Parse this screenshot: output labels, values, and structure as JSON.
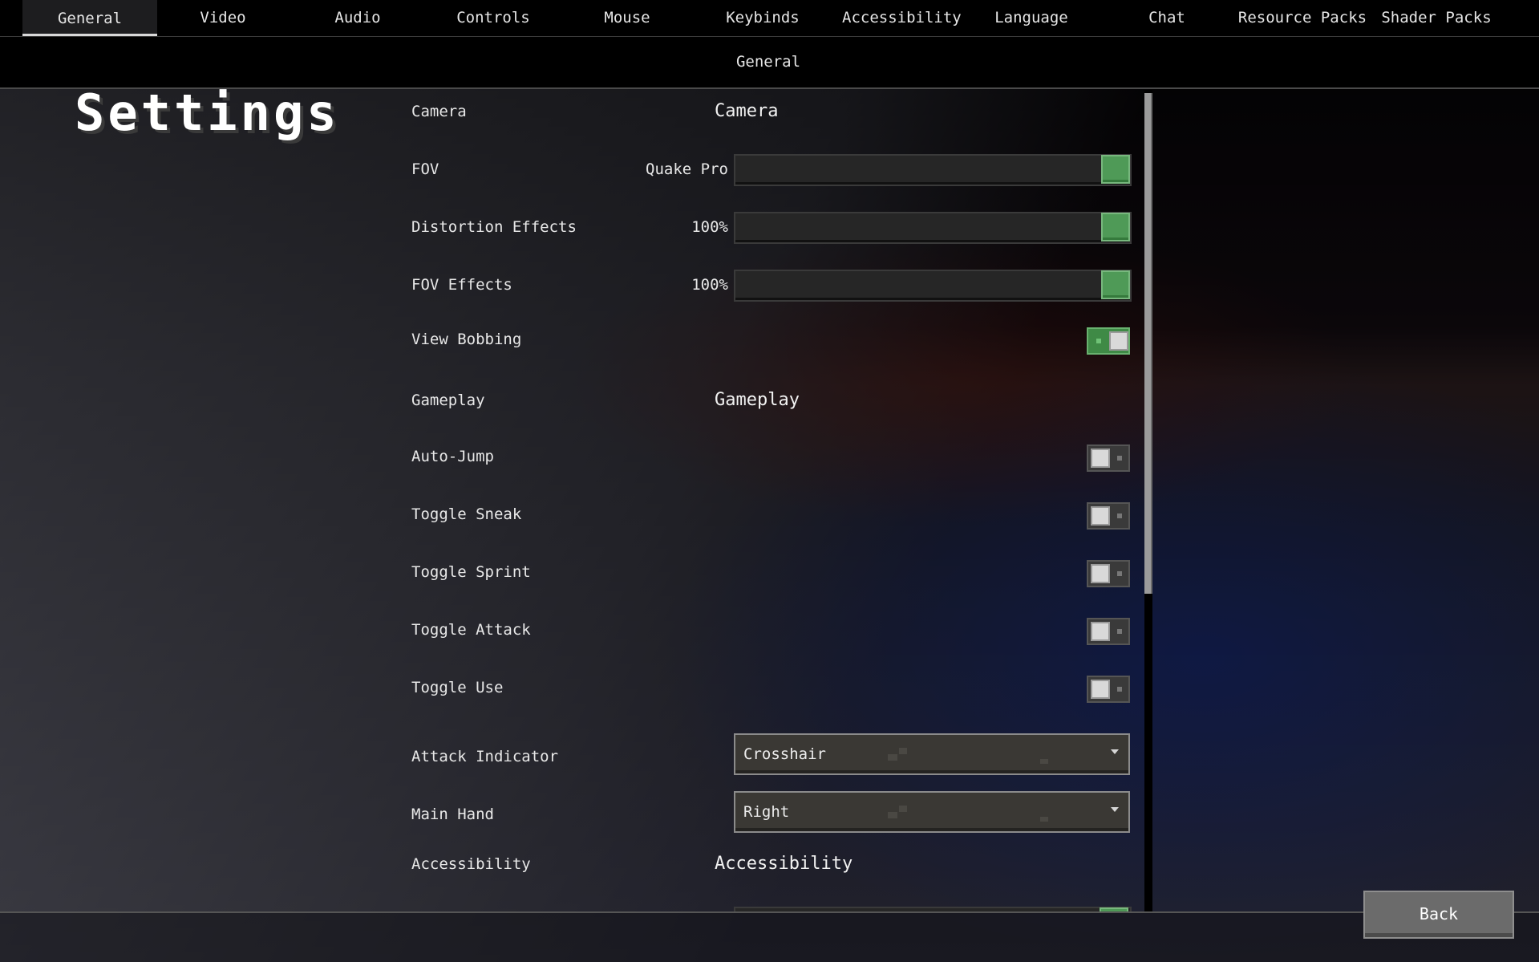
{
  "tabs": [
    {
      "id": "general",
      "label": "General",
      "active": true
    },
    {
      "id": "video",
      "label": "Video"
    },
    {
      "id": "audio",
      "label": "Audio"
    },
    {
      "id": "controls",
      "label": "Controls"
    },
    {
      "id": "mouse",
      "label": "Mouse"
    },
    {
      "id": "keybinds",
      "label": "Keybinds"
    },
    {
      "id": "accessibility",
      "label": "Accessibility"
    },
    {
      "id": "language",
      "label": "Language"
    },
    {
      "id": "chat",
      "label": "Chat"
    },
    {
      "id": "resource-packs",
      "label": "Resource Packs"
    },
    {
      "id": "shader-packs",
      "label": "Shader Packs"
    }
  ],
  "subtabs": {
    "general": "General"
  },
  "page": {
    "title": "Settings"
  },
  "settings": {
    "camera": {
      "label": "Camera",
      "section_title": "Camera"
    },
    "fov": {
      "label": "FOV",
      "value": "Quake Pro",
      "level": 1.0
    },
    "distortion_effects": {
      "label": "Distortion Effects",
      "value": "100%",
      "level": 1.0
    },
    "fov_effects": {
      "label": "FOV Effects",
      "value": "100%",
      "level": 1.0
    },
    "view_bobbing": {
      "label": "View Bobbing",
      "on": true
    },
    "gameplay": {
      "label": "Gameplay",
      "section_title": "Gameplay"
    },
    "auto_jump": {
      "label": "Auto-Jump",
      "on": false
    },
    "toggle_sneak": {
      "label": "Toggle Sneak",
      "on": false
    },
    "toggle_sprint": {
      "label": "Toggle Sprint",
      "on": false
    },
    "toggle_attack": {
      "label": "Toggle Attack",
      "on": false
    },
    "toggle_use": {
      "label": "Toggle Use",
      "on": false
    },
    "attack_indicator": {
      "label": "Attack Indicator",
      "value": "Crosshair"
    },
    "main_hand": {
      "label": "Main Hand",
      "value": "Right"
    },
    "accessibility": {
      "label": "Accessibility",
      "section_title": "Accessibility"
    }
  },
  "footer": {
    "back_label": "Back"
  },
  "colors": {
    "accent_green": "#4f9a57",
    "toggle_on": "#3f8a46",
    "panel_bar": "#000000"
  }
}
